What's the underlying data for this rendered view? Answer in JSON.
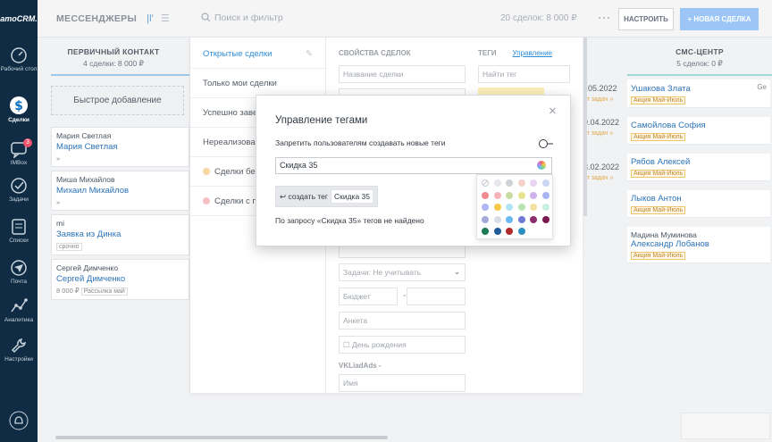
{
  "nav": {
    "logo": "amoCRM.",
    "items": [
      {
        "label": "Рабочий стол",
        "icon": "dashboard-icon"
      },
      {
        "label": "Сделки",
        "icon": "deals-icon"
      },
      {
        "label": "IMBox",
        "icon": "chat-icon",
        "badge": "3"
      },
      {
        "label": "Задачи",
        "icon": "check-icon"
      },
      {
        "label": "Списки",
        "icon": "contacts-icon"
      },
      {
        "label": "Почта",
        "icon": "mail-icon"
      },
      {
        "label": "Аналитика",
        "icon": "analytics-icon"
      },
      {
        "label": "Настройки",
        "icon": "gear-icon"
      }
    ]
  },
  "topbar": {
    "title": "МЕССЕНДЖЕРЫ",
    "search_placeholder": "Поиск и фильтр",
    "deals_count": "20 сделок: 8 000 ₽",
    "more": "···",
    "setup_label": "НАСТРОИТЬ",
    "new_deal_label": "+ НОВАЯ СДЕЛКА"
  },
  "column_left": {
    "name": "ПЕРВИЧНЫЙ КОНТАКТ",
    "sub": "4 сделки: 8 000 ₽",
    "quick_add": "Быстрое добавление",
    "cards": [
      {
        "c1": "Мария Светлая",
        "c2": "Мария Светлая",
        "c3": "»",
        "tag": ""
      },
      {
        "c1": "Миша Михайлов",
        "c2": "Михаил Михайлов",
        "c3": "»",
        "tag": ""
      },
      {
        "c1": "mi",
        "c2": "Заявка из Динка",
        "c3": "",
        "tag": "срочно"
      },
      {
        "c1": "Сергей Димченко",
        "c2": "Сергей Димченко",
        "c3": "8 000 ₽",
        "tag": "Рассылка май"
      }
    ]
  },
  "column_right": {
    "name": "СМС-ЦЕНТР",
    "sub": "5 сделок: 0 ₽",
    "cards": [
      {
        "name": "Ушакова Злата",
        "name2": "",
        "tag": "Акция Май-Июль",
        "extra": "Ge"
      },
      {
        "name": "Самойлова София",
        "name2": "",
        "tag": "Акция Май-Июль",
        "extra": ""
      },
      {
        "name": "Рябов Алексей",
        "name2": "",
        "tag": "Акция Май-Июль",
        "extra": ""
      },
      {
        "name": "Лыков Антон",
        "name2": "",
        "tag": "Акция Май-Июль",
        "extra": ""
      },
      {
        "name": "Мадина Муминова",
        "name2": "Александр Лобанов",
        "tag": "Акция Май-Июль",
        "extra": ""
      }
    ]
  },
  "peek_dates": [
    "..05.2022",
    "9.04.2022",
    "3.02.2022"
  ],
  "peek_task": "ет задач »",
  "filter": {
    "presets": [
      {
        "label": "Открытые сделки",
        "active": true,
        "dot": ""
      },
      {
        "label": "Только мои сделки",
        "active": false,
        "dot": ""
      },
      {
        "label": "Успешно заве",
        "active": false,
        "dot": ""
      },
      {
        "label": "Нереализован",
        "active": false,
        "dot": ""
      },
      {
        "label": "Сделки без",
        "active": false,
        "dot": "#f5d7a4"
      },
      {
        "label": "Сделки с пр",
        "active": false,
        "dot": "#f7c0c4"
      }
    ],
    "properties_title": "СВОЙСТВА СДЕЛОК",
    "deal_name_placeholder": "Название сделки",
    "tasks_select": "Задачи: Не учитывать",
    "budget_placeholder": "Бюджет",
    "budget_dash": "-",
    "survey_placeholder": "Анкета",
    "birthday_placeholder": "День рождения",
    "vk_section": "VKLiadAds -",
    "name_placeholder": "Имя",
    "tags_title": "ТЕГИ",
    "tags_manage": "Управление",
    "tags_search_placeholder": "Найти тег"
  },
  "modal": {
    "title": "Управление тегами",
    "prohibit_label": "Запретить пользователям создавать новые теги",
    "input_value": "Скидка 35",
    "create_label": "↩ создать тег",
    "create_tag": "Скидка 35",
    "not_found": "По запросу «Скидка 35» тегов не найдено",
    "close": "×"
  },
  "palette_colors": [
    [
      "none",
      "#e5e7eb",
      "#cfd2d6",
      "#f5d3c9",
      "#e9d4f2",
      "#cdd5f7"
    ],
    [
      "#f08a8f",
      "#f5b5ba",
      "#c7dba3",
      "#e6e48e",
      "#d0b2ec",
      "#a8b4f2"
    ],
    [
      "#aeb7f2",
      "#f7c94b",
      "#b0e3f3",
      "#b6e3b0",
      "#f4e2a0",
      "#c8f0e0"
    ],
    [
      "#a5a9d9",
      "#d9dde6",
      "#6bb7f0",
      "#6f7bd6",
      "#8b2f6e",
      "#7a1a50"
    ],
    [
      "#1c7a54",
      "#1f5c99",
      "#b32a2a",
      "#2a8fbf"
    ]
  ]
}
